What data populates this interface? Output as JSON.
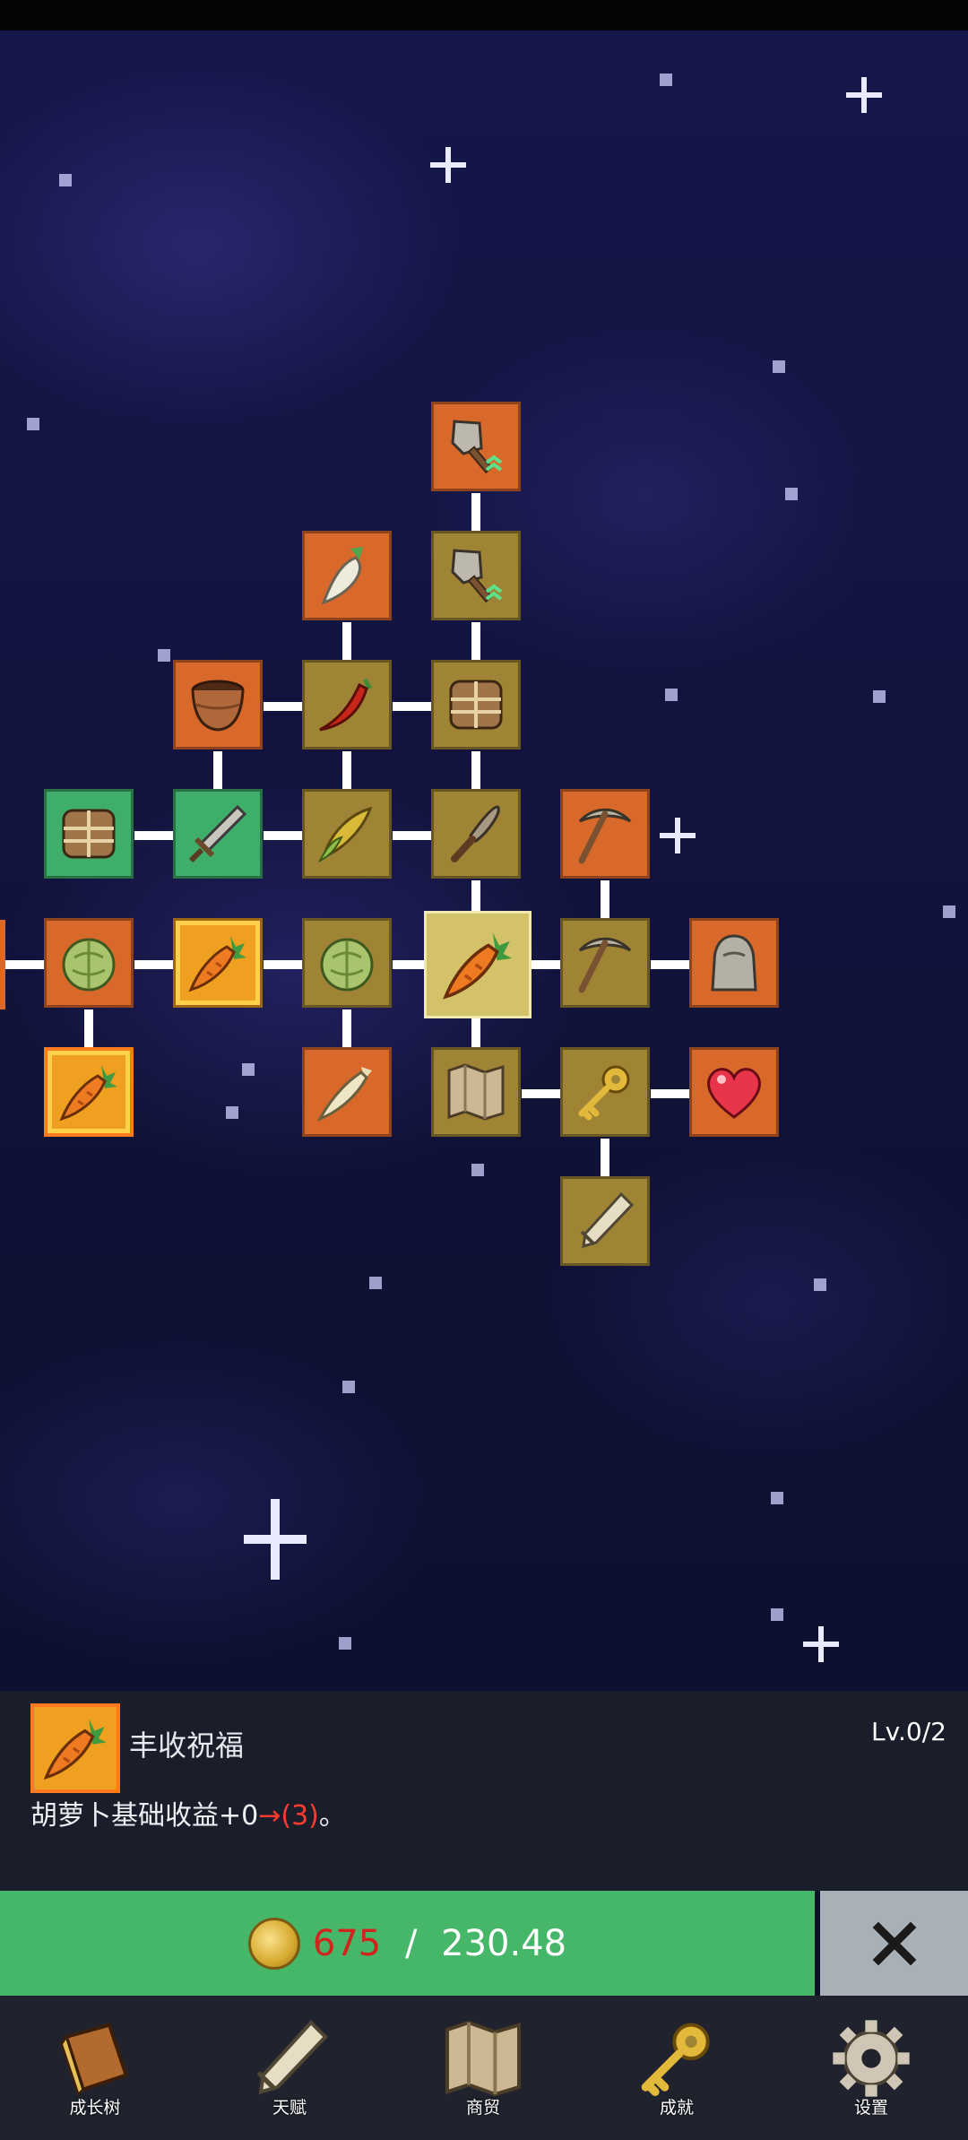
{
  "skill_tree": {
    "nodes": [
      {
        "id": "shovel-top",
        "icon": "shovel-icon",
        "color": "orange"
      },
      {
        "id": "radish",
        "icon": "radish-icon",
        "color": "orange"
      },
      {
        "id": "shovel-2",
        "icon": "shovel-icon",
        "color": "gold"
      },
      {
        "id": "clay-pot",
        "icon": "pot-icon",
        "color": "orange"
      },
      {
        "id": "chili",
        "icon": "chili-icon",
        "color": "gold"
      },
      {
        "id": "crate",
        "icon": "crate-icon",
        "color": "gold"
      },
      {
        "id": "crate-green",
        "icon": "crate-icon",
        "color": "green"
      },
      {
        "id": "sword",
        "icon": "sword-icon",
        "color": "green"
      },
      {
        "id": "corn",
        "icon": "corn-icon",
        "color": "gold"
      },
      {
        "id": "knife",
        "icon": "knife-icon",
        "color": "gold"
      },
      {
        "id": "pickaxe-1",
        "icon": "pickaxe-icon",
        "color": "orange"
      },
      {
        "id": "cabbage-1",
        "icon": "cabbage-icon",
        "color": "orange"
      },
      {
        "id": "carrot-gold",
        "icon": "carrot-icon",
        "color": "glow"
      },
      {
        "id": "cabbage-2",
        "icon": "cabbage-icon",
        "color": "gold"
      },
      {
        "id": "carrot-center",
        "icon": "carrot-icon",
        "color": "selected"
      },
      {
        "id": "pickaxe-2",
        "icon": "pickaxe-icon",
        "color": "gold"
      },
      {
        "id": "statue",
        "icon": "statue-icon",
        "color": "orange"
      },
      {
        "id": "carrot-blessing",
        "icon": "carrot-icon",
        "color": "glow"
      },
      {
        "id": "parsnip",
        "icon": "parsnip-icon",
        "color": "orange"
      },
      {
        "id": "map",
        "icon": "map-icon",
        "color": "gold"
      },
      {
        "id": "key",
        "icon": "key-icon",
        "color": "gold"
      },
      {
        "id": "heart",
        "icon": "heart-icon",
        "color": "orange"
      },
      {
        "id": "scroll",
        "icon": "scroll-icon",
        "color": "gold"
      }
    ]
  },
  "detail": {
    "icon": "carrot-icon",
    "title": "丰收祝福",
    "level": "Lv.0/2",
    "desc_main": "胡萝卜基础收益+0",
    "desc_arrow": "→(3)",
    "desc_end": "。"
  },
  "purchase": {
    "coin_icon": "coin-icon",
    "current": "675",
    "separator": " / ",
    "cost": "230.48"
  },
  "close_icon": "close-icon",
  "nav": [
    {
      "label": "成长树",
      "icon": "book-icon"
    },
    {
      "label": "天赋",
      "icon": "scroll-icon"
    },
    {
      "label": "商贸",
      "icon": "map-icon"
    },
    {
      "label": "成就",
      "icon": "key-icon"
    },
    {
      "label": "设置",
      "icon": "gear-icon"
    }
  ],
  "colors": {
    "orange": "#d9682b",
    "gold": "#a08436",
    "green": "#3fae6a",
    "buy": "#46b668",
    "price": "#d3231c"
  }
}
